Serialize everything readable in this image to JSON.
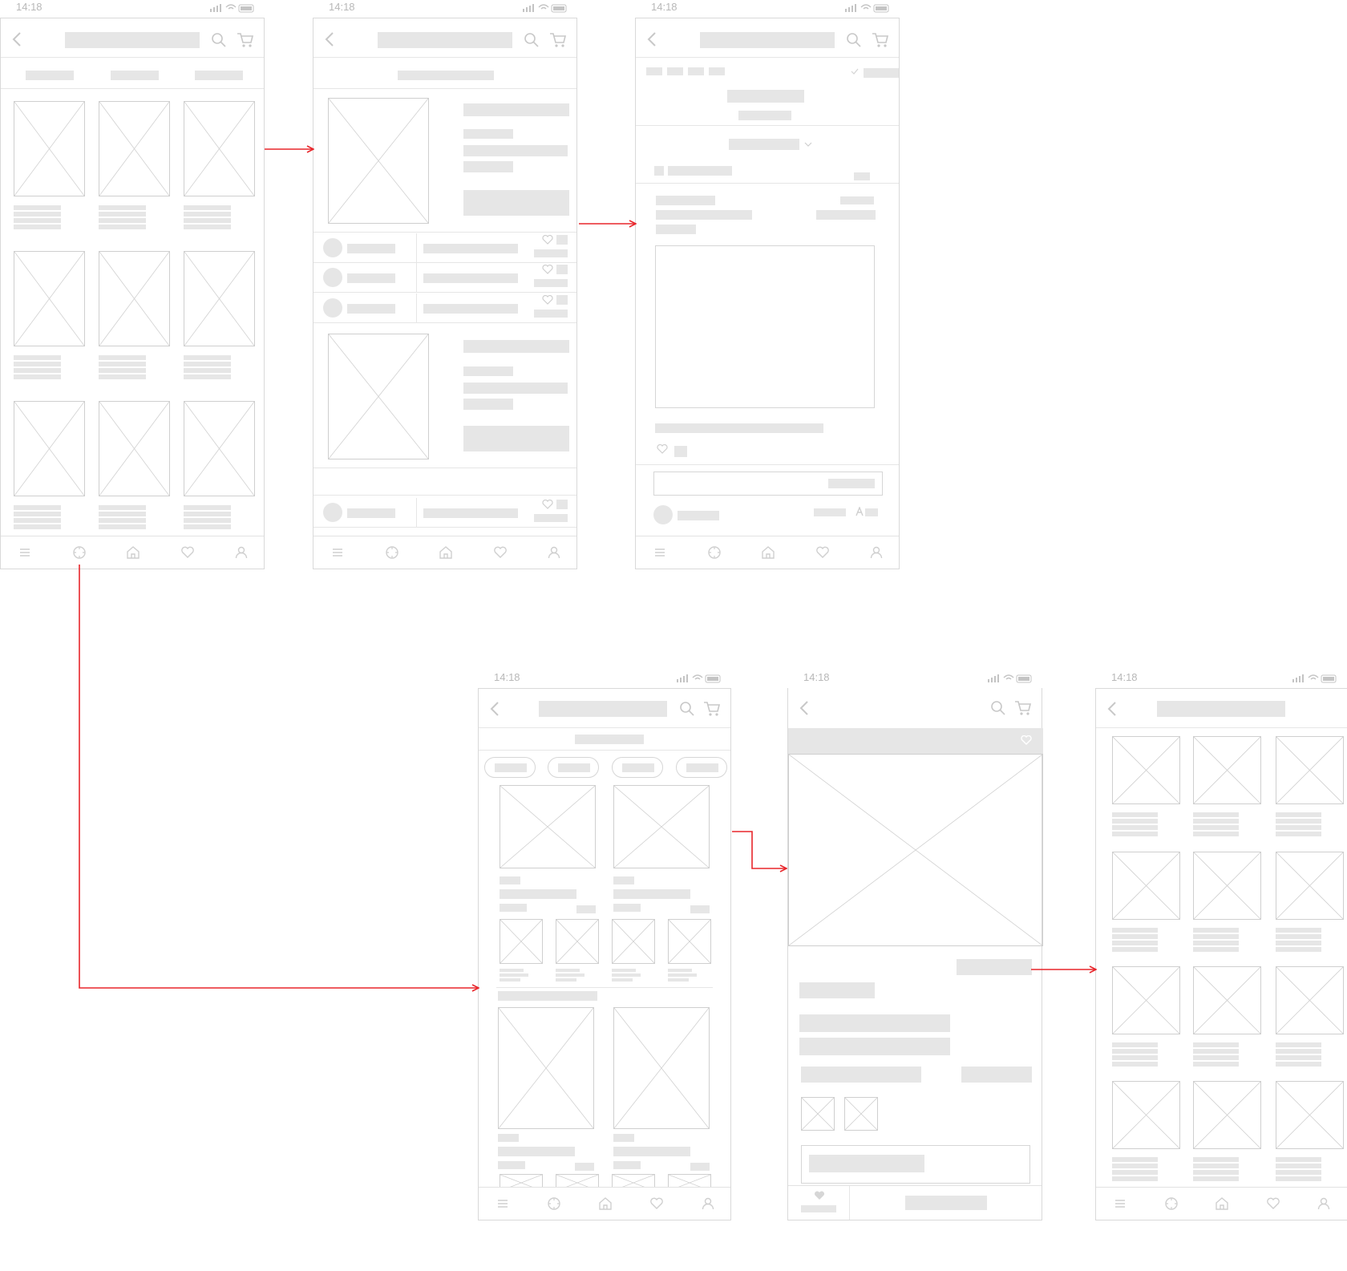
{
  "status_bar": {
    "time": "14:18"
  },
  "colors": {
    "arrow": "#e8262b",
    "placeholder_fill": "#e6e6e6",
    "wire_stroke": "#d0d0d0"
  },
  "icons": {
    "back": "chevron-left-icon",
    "search": "search-icon",
    "cart": "cart-icon",
    "heart": "heart-icon",
    "tabs": [
      "menu-icon",
      "compass-icon",
      "home-icon",
      "heart-icon",
      "user-icon"
    ]
  },
  "screens": [
    {
      "id": "category-grid"
    },
    {
      "id": "product-list"
    },
    {
      "id": "product-review"
    },
    {
      "id": "discover-feed"
    },
    {
      "id": "product-detail"
    },
    {
      "id": "related-grid"
    }
  ],
  "flows": [
    {
      "from": "category-grid",
      "to": "product-list"
    },
    {
      "from": "product-list",
      "to": "product-review"
    },
    {
      "from": "category-grid",
      "to": "discover-feed"
    },
    {
      "from": "discover-feed",
      "to": "product-detail"
    },
    {
      "from": "product-detail",
      "to": "related-grid"
    }
  ]
}
